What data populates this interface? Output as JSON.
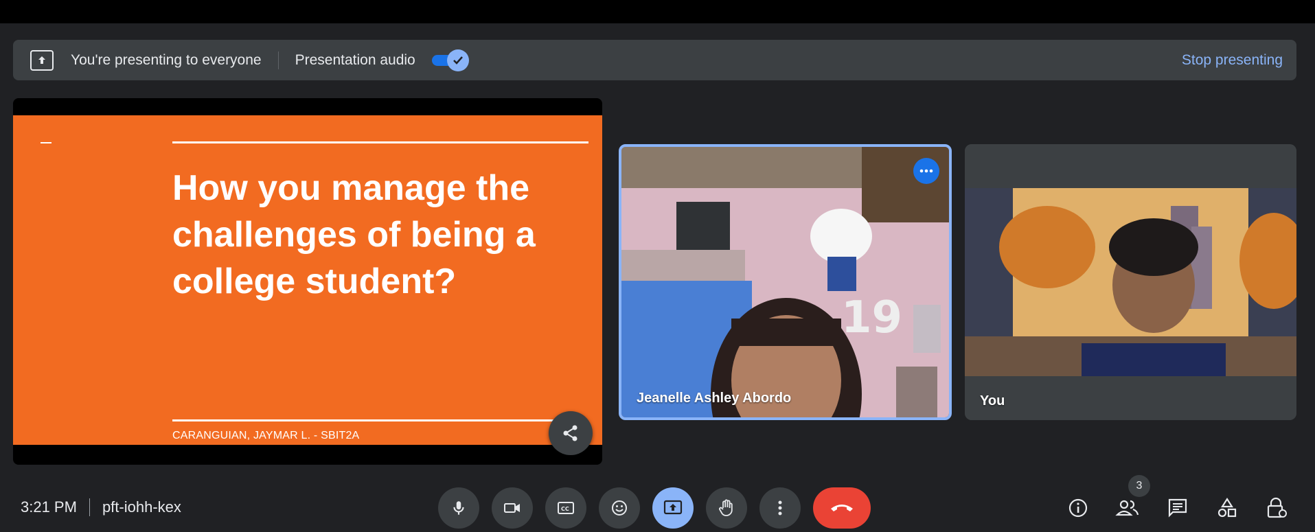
{
  "banner": {
    "presenting_text": "You're presenting to everyone",
    "audio_label": "Presentation audio",
    "audio_enabled": true,
    "stop_label": "Stop presenting"
  },
  "slide": {
    "title": "How you manage the challenges of being a college student?",
    "author": "CARANGUIAN, JAYMAR L. - SBIT2A",
    "background": "#f26b21"
  },
  "participants": [
    {
      "name": "Jeanelle Ashley Abordo",
      "active_speaker": true
    },
    {
      "name": "You",
      "active_speaker": false
    }
  ],
  "meeting": {
    "time": "3:21 PM",
    "code": "pft-iohh-kex",
    "people_count": "3"
  },
  "controls": [
    {
      "name": "microphone",
      "icon": "mic-icon"
    },
    {
      "name": "camera",
      "icon": "video-icon"
    },
    {
      "name": "captions",
      "icon": "cc-icon"
    },
    {
      "name": "reactions",
      "icon": "emoji-icon"
    },
    {
      "name": "present",
      "icon": "present-icon"
    },
    {
      "name": "raise-hand",
      "icon": "hand-icon"
    },
    {
      "name": "more-options",
      "icon": "more-vert-icon"
    },
    {
      "name": "leave-call",
      "icon": "end-call-icon"
    }
  ],
  "colors": {
    "accent": "#8ab4f8",
    "end_call": "#ea4335",
    "surface": "#3c4043",
    "background": "#202124"
  }
}
